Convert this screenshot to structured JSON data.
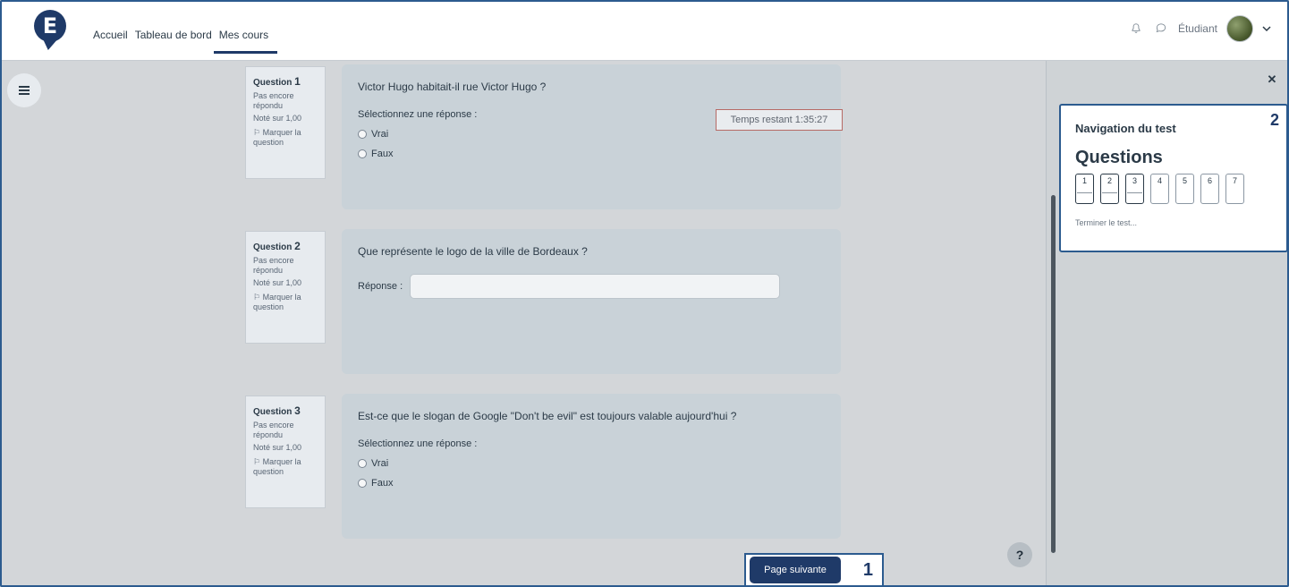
{
  "header": {
    "logo_letter": "E",
    "nav": [
      {
        "label": "Accueil"
      },
      {
        "label": "Tableau de bord"
      },
      {
        "label": "Mes cours"
      }
    ],
    "role_label": "Étudiant"
  },
  "questions": [
    {
      "title": "Question",
      "number": "1",
      "status": "Pas encore répondu",
      "score": "Noté sur 1,00",
      "flag": "Marquer la question",
      "text": "Victor Hugo habitait-il rue Victor Hugo ?",
      "select_label": "Sélectionnez une réponse :",
      "options": [
        "Vrai",
        "Faux"
      ]
    },
    {
      "title": "Question",
      "number": "2",
      "status": "Pas encore répondu",
      "score": "Noté sur 1,00",
      "flag": "Marquer la question",
      "text": "Que représente le logo de la ville de Bordeaux ?",
      "answer_label": "Réponse :"
    },
    {
      "title": "Question",
      "number": "3",
      "status": "Pas encore répondu",
      "score": "Noté sur 1,00",
      "flag": "Marquer la question",
      "text": "Est-ce que le slogan de Google \"Don't be evil\" est toujours valable aujourd'hui ?",
      "select_label": "Sélectionnez une réponse :",
      "options": [
        "Vrai",
        "Faux"
      ]
    }
  ],
  "timer": "Temps restant 1:35:27",
  "next_button": "Page suivante",
  "annotation_1": "1",
  "annotation_2": "2",
  "nav_panel": {
    "title": "Navigation du test",
    "questions_heading": "Questions",
    "question_numbers": [
      "1",
      "2",
      "3",
      "4",
      "5",
      "6",
      "7"
    ],
    "finish_link": "Terminer le test..."
  },
  "help_label": "?"
}
